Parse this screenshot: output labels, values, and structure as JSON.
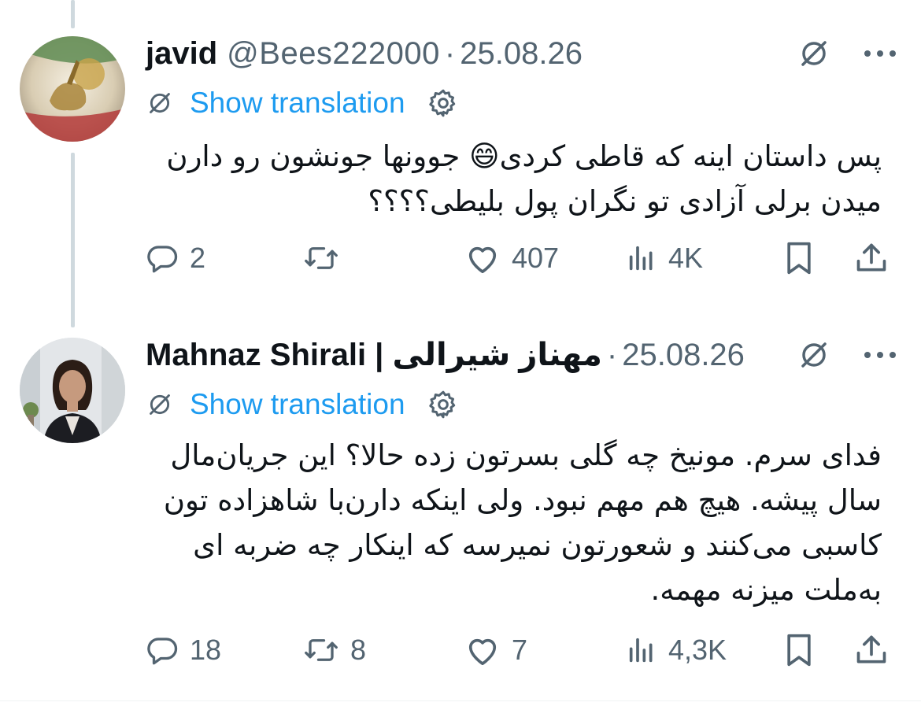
{
  "tweets": [
    {
      "name": "javid",
      "handle": "@Bees222000",
      "separator": "·",
      "date": "25.08.26",
      "translate_label": "Show translation",
      "text": "پس داستان اینه که قاطی کردی😄 جوونها جونشون رو دارن میدن برلی آزادی تو نگران پول بلیطی؟؟؟؟",
      "replies": "2",
      "reposts": "",
      "likes": "407",
      "views": "4K"
    },
    {
      "name": "Mahnaz Shirali | مهناز شیرالی",
      "handle": "",
      "separator": "·",
      "date": "25.08.26",
      "translate_label": "Show translation",
      "text": "فدای سرم. مونیخ چه گلی بسرتون زده حالا؟ این جریان‌مال سال پیشه. هیچ هم مهم نبود. ولی اینکه دارن‌با شاهزاده تون کاسبی می‌کنند و شعورتون نمیرسه که اینکار چه ضربه ای به‌ملت میزنه مهمه.",
      "replies": "18",
      "reposts": "8",
      "likes": "7",
      "views": "4,3K"
    }
  ],
  "colors": {
    "link": "#1d9bf0",
    "muted": "#536471",
    "text": "#0f1419",
    "thread_line": "#cfd9de"
  }
}
